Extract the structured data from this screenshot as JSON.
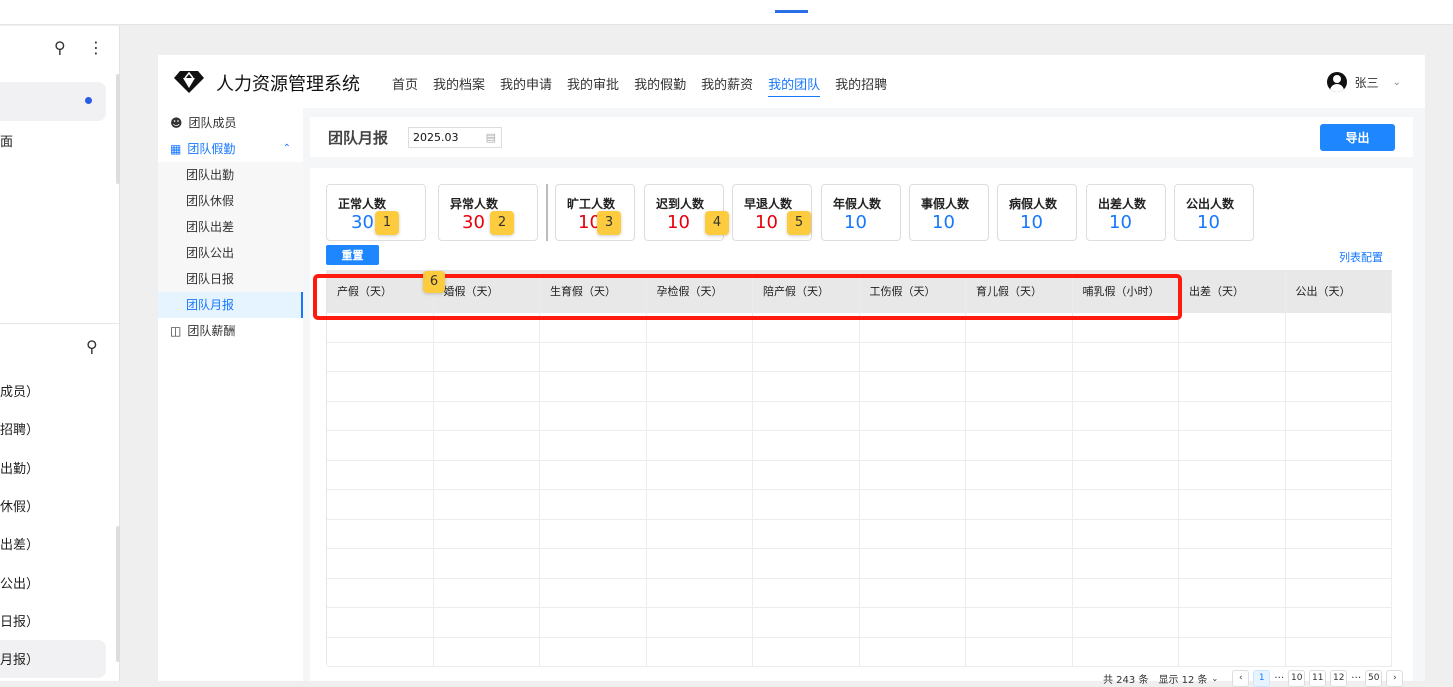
{
  "left_panel": {
    "partial_text": "面",
    "items": [
      "成员）",
      "招聘）",
      "出勤）",
      "休假）",
      "出差）",
      "公出）",
      "日报）",
      "月报）"
    ]
  },
  "app": {
    "title": "人力资源管理系统",
    "nav": [
      "首页",
      "我的档案",
      "我的申请",
      "我的审批",
      "我的假勤",
      "我的薪资",
      "我的团队",
      "我的招聘"
    ],
    "nav_active": 6,
    "user": "张三"
  },
  "sidebar": {
    "members": "团队成员",
    "attendance": "团队假勤",
    "sub": [
      "团队出勤",
      "团队休假",
      "团队出差",
      "团队公出",
      "团队日报",
      "团队月报"
    ],
    "sub_active": 5,
    "salary": "团队薪酬"
  },
  "titlebar": {
    "title": "团队月报",
    "date": "2025.03",
    "export": "导出"
  },
  "stats": [
    {
      "label": "正常人数",
      "value": "30",
      "color": "#1677ff"
    },
    {
      "label": "异常人数",
      "value": "30",
      "color": "#e8000b"
    },
    {
      "label": "旷工人数",
      "value": "10",
      "color": "#e8000b"
    },
    {
      "label": "迟到人数",
      "value": "10",
      "color": "#e8000b"
    },
    {
      "label": "早退人数",
      "value": "10",
      "color": "#e8000b"
    },
    {
      "label": "年假人数",
      "value": "10",
      "color": "#1677ff"
    },
    {
      "label": "事假人数",
      "value": "10",
      "color": "#1677ff"
    },
    {
      "label": "病假人数",
      "value": "10",
      "color": "#1677ff"
    },
    {
      "label": "出差人数",
      "value": "10",
      "color": "#1677ff"
    },
    {
      "label": "公出人数",
      "value": "10",
      "color": "#1677ff"
    }
  ],
  "badges": [
    "1",
    "2",
    "3",
    "4",
    "5",
    "6"
  ],
  "reset": "重置",
  "column_config": "列表配置",
  "columns": [
    "产假（天）",
    "婚假（天）",
    "生育假（天）",
    "孕检假（天）",
    "陪产假（天）",
    "工伤假（天）",
    "育儿假（天）",
    "哺乳假（小时）",
    "出差（天）",
    "公出（天）"
  ],
  "pagination": {
    "total": "共 243 条",
    "page_size": "显示 12 条",
    "pages": [
      "1",
      "…",
      "10",
      "11",
      "12",
      "…",
      "50"
    ],
    "prev": "‹",
    "next": "›"
  }
}
